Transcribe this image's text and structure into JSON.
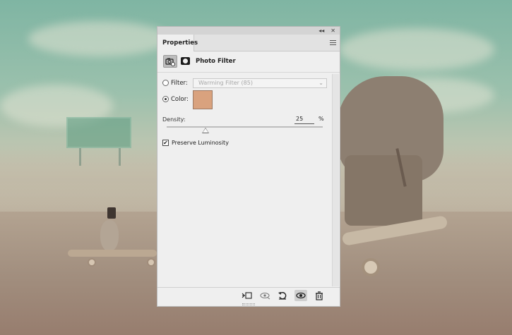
{
  "panel": {
    "collapse_icon": "double-chevron-left-icon",
    "close_icon": "close-icon",
    "tab_label": "Properties",
    "menu_icon": "panel-menu-icon",
    "adjustment_title": "Photo Filter",
    "filter_label": "Filter:",
    "filter_value": "Warming Filter (85)",
    "filter_selected": false,
    "color_label": "Color:",
    "color_selected": true,
    "color_value": "#d9a27e",
    "density_label": "Density:",
    "density_value": "25",
    "density_unit": "%",
    "preserve_luminosity_label": "Preserve Luminosity",
    "preserve_luminosity_checked": true,
    "bottom_buttons": [
      "clip-to-layer-icon",
      "view-previous-state-icon",
      "reset-icon",
      "visibility-eye-icon",
      "trash-icon"
    ]
  }
}
